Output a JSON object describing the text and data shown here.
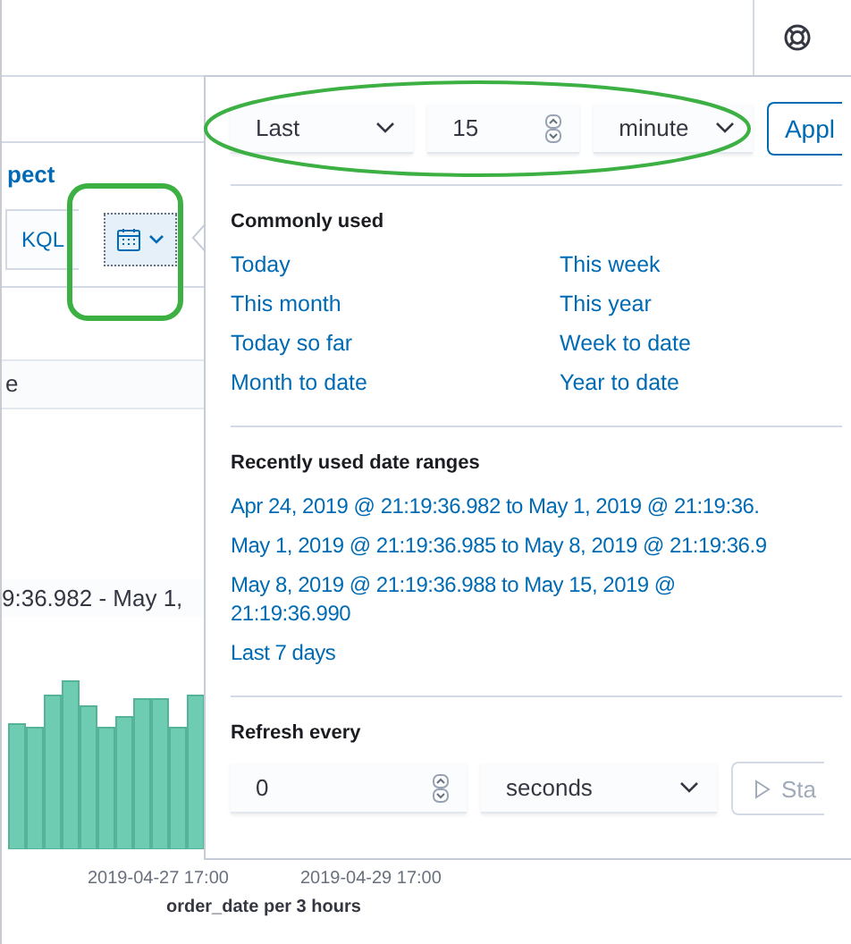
{
  "background": {
    "link": "pect",
    "query_language": "KQL",
    "field_text": "e",
    "time_range_text": "9:36.982 - May 1,",
    "chart": {
      "x_tick_labels": [
        "2019-04-27 17:00",
        "2019-04-29 17:00"
      ],
      "x_axis_title": "order_date per 3 hours"
    }
  },
  "quick_select": {
    "direction": "Last",
    "amount": "15",
    "unit": "minute",
    "apply_button": "Appl"
  },
  "commonly_used": {
    "title": "Commonly used",
    "items": [
      "Today",
      "This week",
      "This month",
      "This year",
      "Today so far",
      "Week to date",
      "Month to date",
      "Year to date"
    ]
  },
  "recently_used": {
    "title": "Recently used date ranges",
    "items": [
      "Apr 24, 2019 @ 21:19:36.982 to May 1, 2019 @ 21:19:36.",
      "May 1, 2019 @ 21:19:36.985 to May 8, 2019 @ 21:19:36.9",
      "May 8, 2019 @ 21:19:36.988 to May 15, 2019 @ 21:19:36.990",
      "Last 7 days"
    ]
  },
  "refresh": {
    "title": "Refresh every",
    "amount": "0",
    "unit": "seconds",
    "start_button": "Sta"
  }
}
